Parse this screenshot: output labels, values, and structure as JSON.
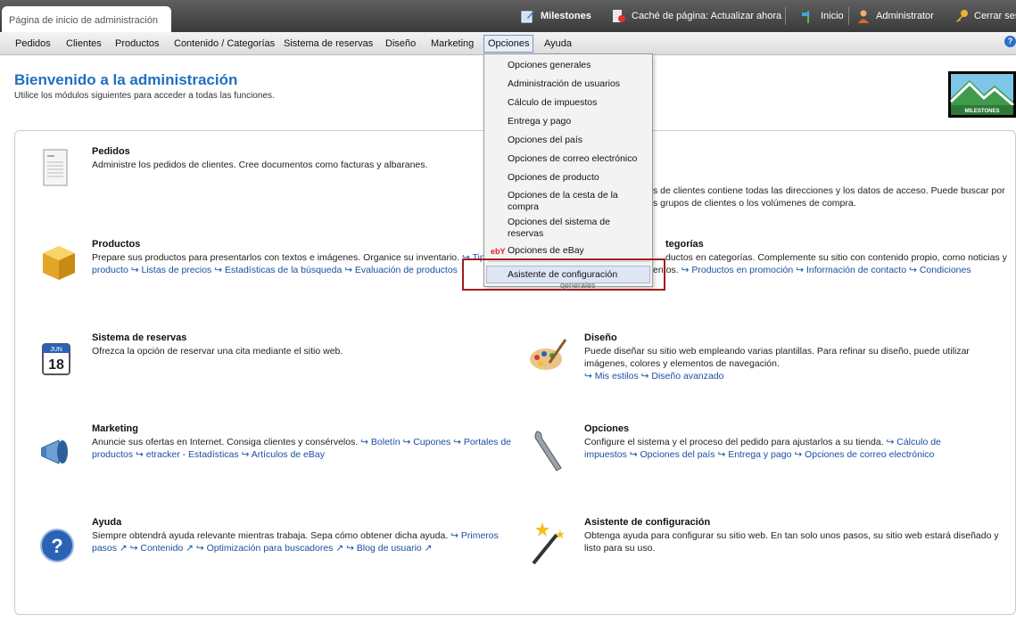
{
  "topbar": {
    "breadcrumb": "Página de inicio de administración",
    "shop_name": "Milestones",
    "cache_label": "Caché de página: Actualizar ahora",
    "home_label": "Inicio",
    "user_label": "Administrator",
    "logout_label": "Cerrar sesió"
  },
  "menu": {
    "items": [
      "Pedidos",
      "Clientes",
      "Productos",
      "Contenido / Categorías",
      "Sistema de reservas",
      "Diseño",
      "Marketing",
      "Opciones",
      "Ayuda"
    ],
    "active": "Opciones"
  },
  "header": {
    "title": "Bienvenido a la administración",
    "subtitle": "Utilice los módulos siguientes para acceder a todas las funciones.",
    "logo_text": "MILESTONES"
  },
  "dropdown": {
    "items": [
      "Opciones generales",
      "Administración de usuarios",
      "Cálculo de impuestos",
      "Entrega y pago",
      "Opciones del país",
      "Opciones de correo electrónico",
      "Opciones de producto",
      "Opciones de la cesta de la compra",
      "Opciones del sistema de reservas",
      "Opciones de eBay",
      "Asistente de configuración"
    ],
    "ebay_badge": "ebY"
  },
  "modules": {
    "pedidos": {
      "title": "Pedidos",
      "desc": "Administre los pedidos de clientes. Cree documentos como facturas y albaranes."
    },
    "clientes": {
      "desc_line1": "s de clientes contiene todas las direcciones y los datos de acceso. Puede buscar por",
      "desc_line2": "s grupos de clientes o los volúmenes de compra."
    },
    "productos": {
      "title": "Productos",
      "desc": "Prepare sus productos para presentarlos con textos e imágenes. Organice su inventario.",
      "links_row1": "↪ Tip",
      "links": [
        "producto",
        "↪ Listas de precios",
        "↪ Estadísticas de la búsqueda",
        "↪ Evaluación de productos"
      ]
    },
    "contenido": {
      "title_tail": "tegorías",
      "desc_line1": "ductos en categorías. Complemente su sitio con contenido propio, como noticias y",
      "desc_line2_a": "cip",
      "desc_line2_b": "entos.",
      "links": [
        "↪ Productos en promoción",
        "↪ Información de contacto",
        "↪ Condiciones"
      ],
      "tail": "generales"
    },
    "reservas": {
      "title": "Sistema de reservas",
      "desc": "Ofrezca la opción de reservar una cita mediante el sitio web.",
      "calendar_num": "18",
      "calendar_month": "JUN"
    },
    "diseno": {
      "title": "Diseño",
      "desc_line1": "Puede diseñar su sitio web empleando varias plantillas. Para refinar su diseño, puede utilizar",
      "desc_line2": "imágenes, colores y elementos de navegación.",
      "links": [
        "↪ Mis estilos",
        "↪ Diseño avanzado"
      ]
    },
    "marketing": {
      "title": "Marketing",
      "desc": "Anuncie sus ofertas en Internet. Consiga clientes y consérvelos.",
      "links_row1": [
        "↪ Boletín",
        "↪ Cupones",
        "↪ Portales de"
      ],
      "links_row2": [
        "productos",
        "↪ etracker - Estadísticas",
        "↪ Artículos de eBay"
      ]
    },
    "opciones": {
      "title": "Opciones",
      "desc": "Configure el sistema y el proceso del pedido para ajustarlos a su tienda.",
      "link_row1": "↪ Cálculo de",
      "links_row2": [
        "impuestos",
        "↪ Opciones del país",
        "↪ Entrega y pago",
        "↪ Opciones de correo electrónico"
      ]
    },
    "ayuda": {
      "title": "Ayuda",
      "desc": "Siempre obtendrá ayuda relevante mientras trabaja. Sepa cómo obtener dicha ayuda.",
      "link_row1": "↪ Primeros",
      "links_row2": [
        "pasos ↗",
        "↪ Contenido ↗",
        "↪ Optimización para buscadores ↗",
        "↪ Blog de usuario ↗"
      ]
    },
    "asistente": {
      "title": "Asistente de configuración",
      "desc_line1": "Obtenga ayuda para configurar su sitio web. En tan solo unos pasos, su sitio web estará diseñado y",
      "desc_line2": "listo para su uso."
    }
  }
}
